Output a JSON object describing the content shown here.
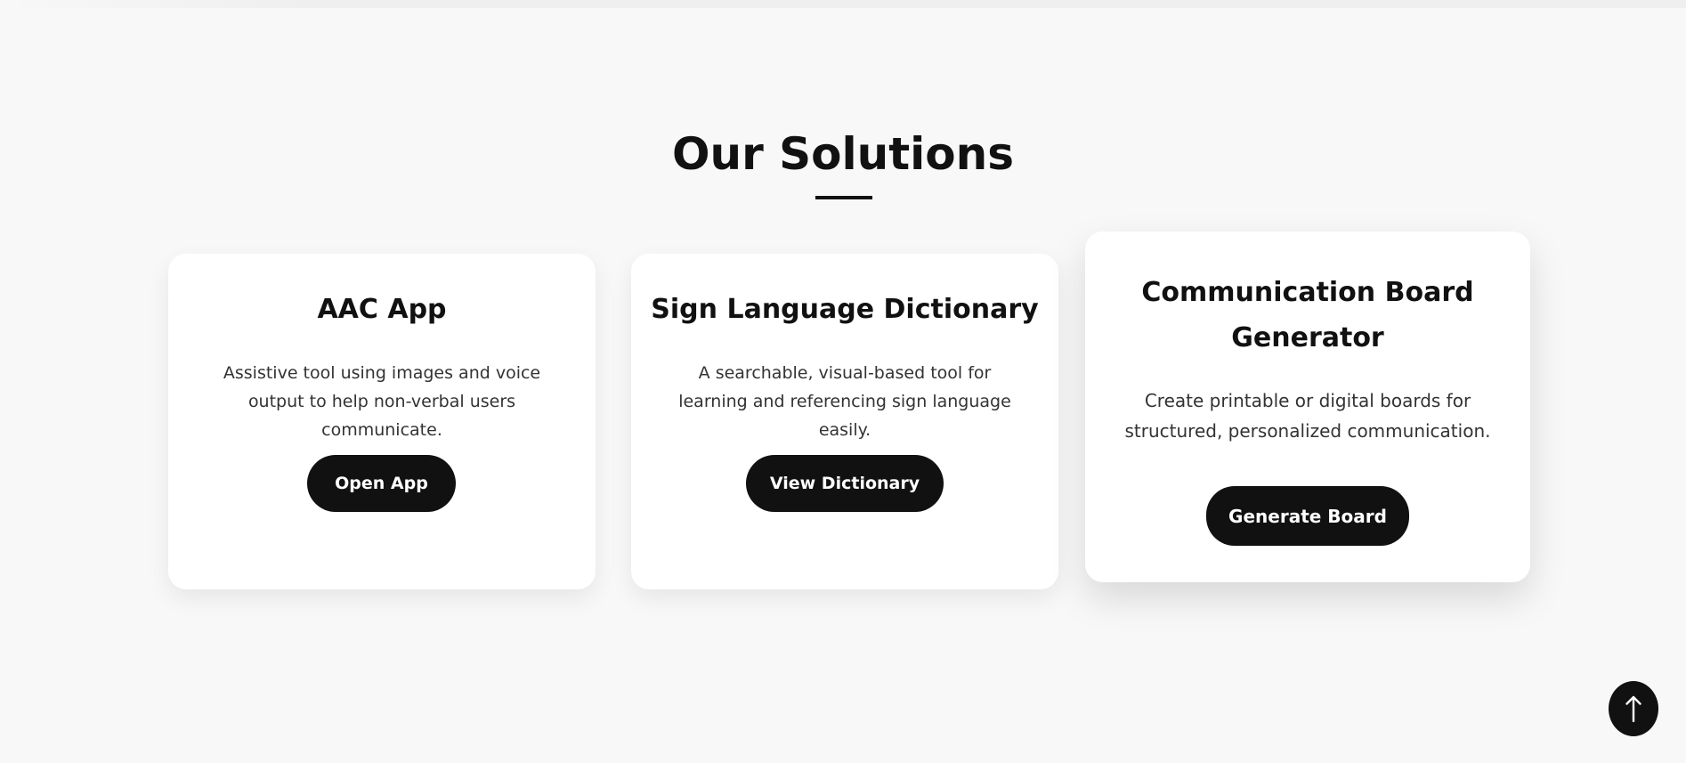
{
  "section": {
    "title": "Our Solutions"
  },
  "cards": [
    {
      "title": "AAC App",
      "description": "Assistive tool using images and voice output to help non-verbal users communicate.",
      "button_label": "Open App"
    },
    {
      "title": "Sign Language Dictionary",
      "description": "A searchable, visual-based tool for learning and referencing sign language easily.",
      "button_label": "View Dictionary"
    },
    {
      "title": "Communication Board Generator",
      "description": "Create printable or digital boards for structured, personalized communication.",
      "button_label": "Generate Board"
    }
  ],
  "scroll_top": {
    "icon": "arrow-up-icon"
  },
  "colors": {
    "background": "#f8f8f8",
    "card_background": "#ffffff",
    "button_background": "#111111",
    "button_text": "#ffffff",
    "heading_text": "#111111",
    "body_text": "#333333"
  }
}
